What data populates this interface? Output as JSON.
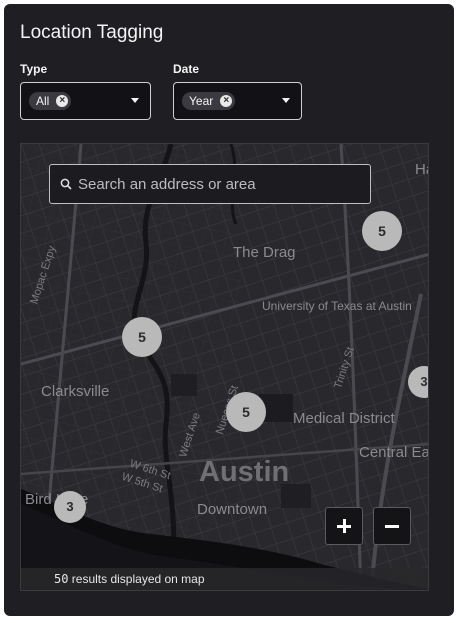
{
  "panel": {
    "title": "Location Tagging"
  },
  "filters": {
    "type": {
      "label": "Type",
      "chip": "All"
    },
    "date": {
      "label": "Date",
      "chip": "Year"
    }
  },
  "map": {
    "search_placeholder": "Search an address or area",
    "places": {
      "the_drag": "The Drag",
      "university": "University of Texas at Austin",
      "clarksville": "Clarksville",
      "medical_district": "Medical District",
      "central_east": "Central Ea",
      "austin": "Austin",
      "downtown": "Downtown",
      "bird_lake": "Bird Lake",
      "ha": "Ha"
    },
    "streets": {
      "mopac": "Mopac Expy",
      "west_ave": "West Ave",
      "nueces": "Nueces St",
      "trinity": "Trinity St",
      "w6th": "W 6th St",
      "w5th": "W 5th St"
    },
    "clusters": [
      {
        "id": "ne",
        "count": "5"
      },
      {
        "id": "west",
        "count": "5"
      },
      {
        "id": "center",
        "count": "5"
      },
      {
        "id": "east",
        "count": "3"
      },
      {
        "id": "southwest",
        "count": "3"
      }
    ],
    "results_count": "50",
    "results_text": " results displayed on map"
  }
}
